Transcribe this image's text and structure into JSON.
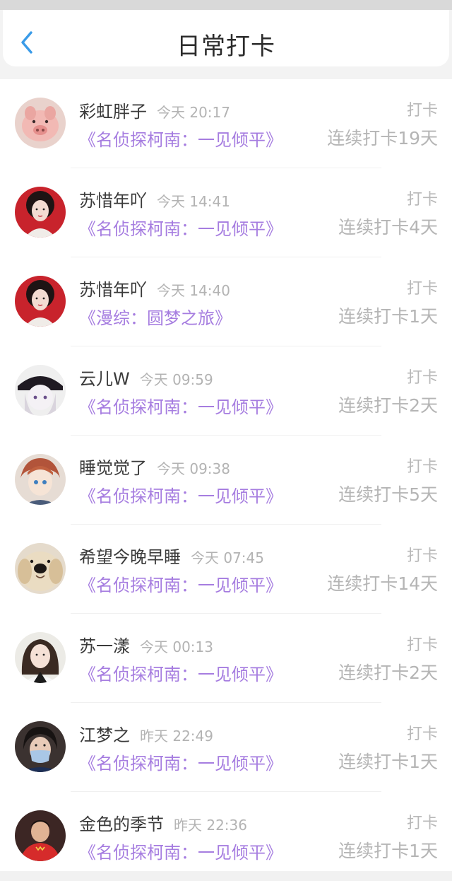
{
  "header": {
    "back_icon": "chevron-left-icon",
    "title": "日常打卡",
    "accent": "#3a9be8"
  },
  "colors": {
    "book_link": "#a67de0",
    "muted": "#b5b5b5"
  },
  "entries": [
    {
      "user": "彩虹胖子",
      "time": "今天 20:17",
      "tag": "打卡",
      "book": "《名侦探柯南：一见倾平》",
      "streak": "连续打卡19天",
      "avatar": "pig-avatar"
    },
    {
      "user": "苏惜年吖",
      "time": "今天 14:41",
      "tag": "打卡",
      "book": "《名侦探柯南：一见倾平》",
      "streak": "连续打卡4天",
      "avatar": "woman-red-avatar"
    },
    {
      "user": "苏惜年吖",
      "time": "今天 14:40",
      "tag": "打卡",
      "book": "《漫综：圆梦之旅》",
      "streak": "连续打卡1天",
      "avatar": "woman-red-avatar"
    },
    {
      "user": "云儿W",
      "time": "今天 09:59",
      "tag": "打卡",
      "book": "《名侦探柯南：一见倾平》",
      "streak": "连续打卡2天",
      "avatar": "anime-hat-avatar"
    },
    {
      "user": "睡觉觉了",
      "time": "今天 09:38",
      "tag": "打卡",
      "book": "《名侦探柯南：一见倾平》",
      "streak": "连续打卡5天",
      "avatar": "anime-boy-avatar"
    },
    {
      "user": "希望今晚早睡",
      "time": "今天 07:45",
      "tag": "打卡",
      "book": "《名侦探柯南：一见倾平》",
      "streak": "连续打卡14天",
      "avatar": "dog-avatar"
    },
    {
      "user": "苏一漾",
      "time": "今天 00:13",
      "tag": "打卡",
      "book": "《名侦探柯南：一见倾平》",
      "streak": "连续打卡2天",
      "avatar": "girl-avatar"
    },
    {
      "user": "江梦之",
      "time": "昨天 22:49",
      "tag": "打卡",
      "book": "《名侦探柯南：一见倾平》",
      "streak": "连续打卡1天",
      "avatar": "mask-avatar"
    },
    {
      "user": "金色的季节",
      "time": "昨天 22:36",
      "tag": "打卡",
      "book": "《名侦探柯南：一见倾平》",
      "streak": "连续打卡1天",
      "avatar": "athlete-avatar"
    }
  ]
}
